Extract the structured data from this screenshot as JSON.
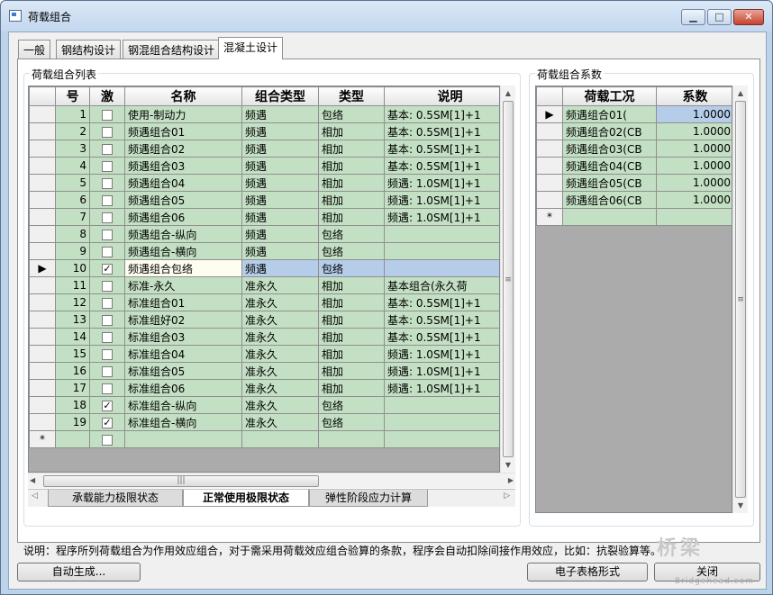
{
  "window": {
    "title": "荷载组合"
  },
  "tabs": [
    {
      "label": "一般",
      "active": false
    },
    {
      "label": "钢结构设计",
      "active": false
    },
    {
      "label": "钢混组合结构设计",
      "active": false
    },
    {
      "label": "混凝土设计",
      "active": true
    }
  ],
  "list_group": {
    "label": "荷载组合列表"
  },
  "coef_group": {
    "label": "荷载组合系数"
  },
  "list_table": {
    "columns": [
      "",
      "号",
      "激",
      "名称",
      "组合类型",
      "类型",
      "说明"
    ],
    "rows": [
      {
        "no": "1",
        "active": false,
        "name": "使用-制动力",
        "combo": "频遇",
        "type": "包络",
        "desc": "基本: 0.5SM[1]+1"
      },
      {
        "no": "2",
        "active": false,
        "name": "频遇组合01",
        "combo": "频遇",
        "type": "相加",
        "desc": "基本: 0.5SM[1]+1"
      },
      {
        "no": "3",
        "active": false,
        "name": "频遇组合02",
        "combo": "频遇",
        "type": "相加",
        "desc": "基本: 0.5SM[1]+1"
      },
      {
        "no": "4",
        "active": false,
        "name": "频遇组合03",
        "combo": "频遇",
        "type": "相加",
        "desc": "基本: 0.5SM[1]+1"
      },
      {
        "no": "5",
        "active": false,
        "name": "频遇组合04",
        "combo": "频遇",
        "type": "相加",
        "desc": "频遇: 1.0SM[1]+1"
      },
      {
        "no": "6",
        "active": false,
        "name": "频遇组合05",
        "combo": "频遇",
        "type": "相加",
        "desc": "频遇: 1.0SM[1]+1"
      },
      {
        "no": "7",
        "active": false,
        "name": "频遇组合06",
        "combo": "频遇",
        "type": "相加",
        "desc": "频遇: 1.0SM[1]+1"
      },
      {
        "no": "8",
        "active": false,
        "name": "频遇组合-纵向",
        "combo": "频遇",
        "type": "包络",
        "desc": ""
      },
      {
        "no": "9",
        "active": false,
        "name": "频遇组合-横向",
        "combo": "频遇",
        "type": "包络",
        "desc": ""
      },
      {
        "no": "10",
        "active": true,
        "name": "频遇组合包络",
        "combo": "频遇",
        "type": "包络",
        "desc": ""
      },
      {
        "no": "11",
        "active": false,
        "name": "标准-永久",
        "combo": "准永久",
        "type": "相加",
        "desc": "基本组合(永久荷"
      },
      {
        "no": "12",
        "active": false,
        "name": "标准组合01",
        "combo": "准永久",
        "type": "相加",
        "desc": "基本: 0.5SM[1]+1"
      },
      {
        "no": "13",
        "active": false,
        "name": "标准组好02",
        "combo": "准永久",
        "type": "相加",
        "desc": "基本: 0.5SM[1]+1"
      },
      {
        "no": "14",
        "active": false,
        "name": "标准组合03",
        "combo": "准永久",
        "type": "相加",
        "desc": "基本: 0.5SM[1]+1"
      },
      {
        "no": "15",
        "active": false,
        "name": "标准组合04",
        "combo": "准永久",
        "type": "相加",
        "desc": "频遇: 1.0SM[1]+1"
      },
      {
        "no": "16",
        "active": false,
        "name": "标准组合05",
        "combo": "准永久",
        "type": "相加",
        "desc": "频遇: 1.0SM[1]+1"
      },
      {
        "no": "17",
        "active": false,
        "name": "标准组合06",
        "combo": "准永久",
        "type": "相加",
        "desc": "频遇: 1.0SM[1]+1"
      },
      {
        "no": "18",
        "active": true,
        "name": "标准组合-纵向",
        "combo": "准永久",
        "type": "包络",
        "desc": ""
      },
      {
        "no": "19",
        "active": true,
        "name": "标准组合-横向",
        "combo": "准永久",
        "type": "包络",
        "desc": ""
      }
    ],
    "current_row": "10",
    "new_row_marker": "*"
  },
  "coef_table": {
    "columns": [
      "",
      "荷载工况",
      "系数"
    ],
    "rows": [
      {
        "case": "频遇组合01(",
        "factor": "1.0000"
      },
      {
        "case": "频遇组合02(CB",
        "factor": "1.0000"
      },
      {
        "case": "频遇组合03(CB",
        "factor": "1.0000"
      },
      {
        "case": "频遇组合04(CB",
        "factor": "1.0000"
      },
      {
        "case": "频遇组合05(CB",
        "factor": "1.0000"
      },
      {
        "case": "频遇组合06(CB",
        "factor": "1.0000"
      }
    ],
    "new_row_marker": "*"
  },
  "sheet_tabs": [
    {
      "label": "承载能力极限状态",
      "active": false
    },
    {
      "label": "正常使用极限状态",
      "active": true
    },
    {
      "label": "弹性阶段应力计算",
      "active": false
    }
  ],
  "note": "说明：程序所列荷载组合为作用效应组合，对于需采用荷载效应组合验算的条款，程序会自动扣除间接作用效应，比如：抗裂验算等。",
  "buttons": {
    "auto_generate": "自动生成...",
    "spreadsheet": "电子表格形式",
    "close": "关闭"
  },
  "watermark": {
    "text": "桥梁",
    "url": "Bridgehead.com"
  },
  "icons": {
    "minimize": "minimize-icon",
    "maximize": "maximize-icon",
    "close": "close-icon",
    "row_pointer": "row-pointer-icon"
  }
}
